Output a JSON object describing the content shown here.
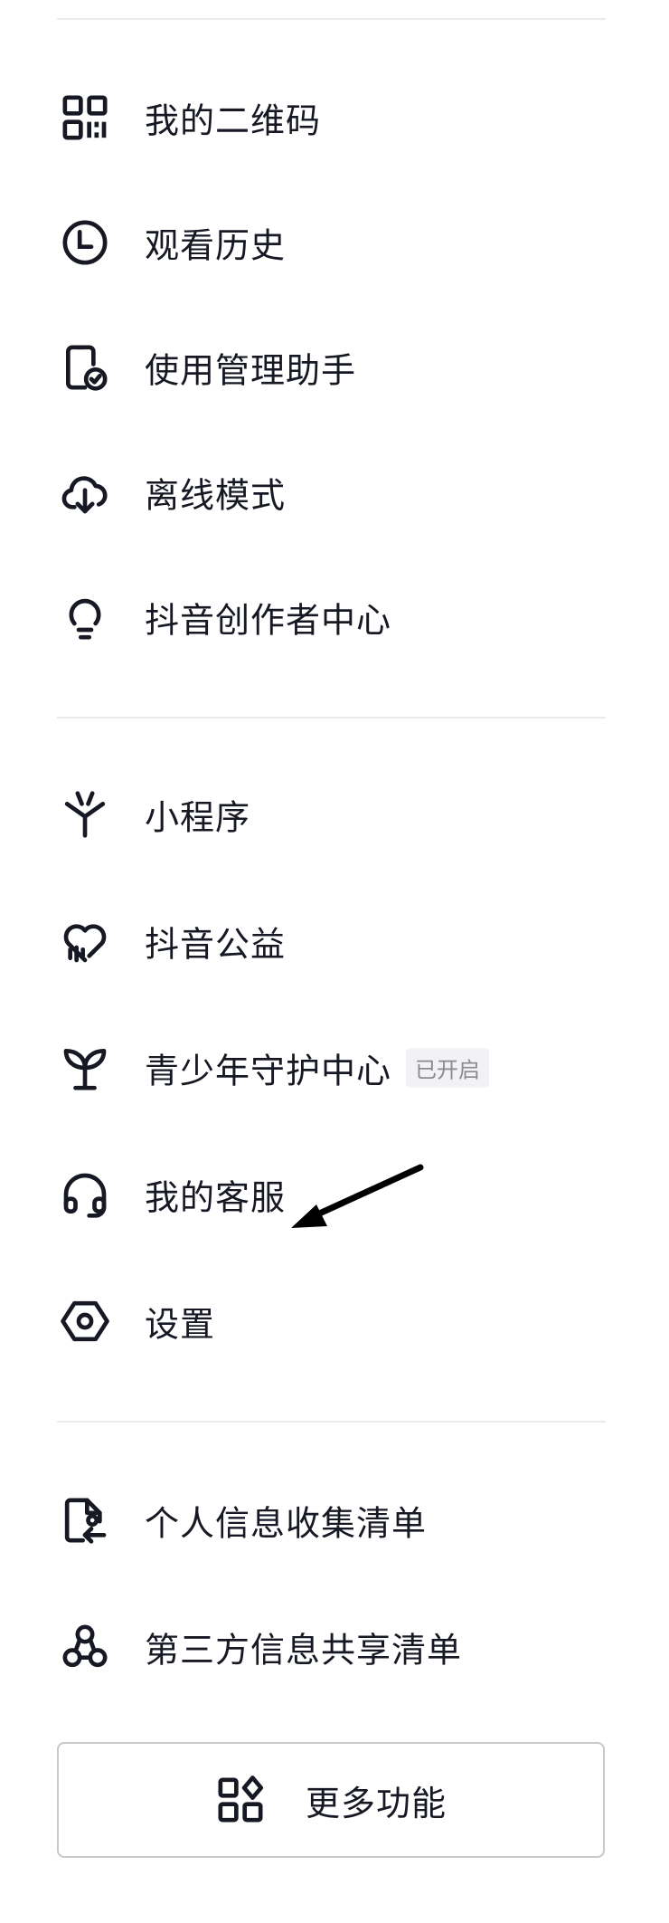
{
  "menu": {
    "section1": [
      {
        "label": "我的二维码",
        "icon": "qr-code-icon"
      },
      {
        "label": "观看历史",
        "icon": "clock-icon"
      },
      {
        "label": "使用管理助手",
        "icon": "phone-check-icon"
      },
      {
        "label": "离线模式",
        "icon": "cloud-download-icon"
      },
      {
        "label": "抖音创作者中心",
        "icon": "lightbulb-icon"
      }
    ],
    "section2": [
      {
        "label": "小程序",
        "icon": "mini-program-icon"
      },
      {
        "label": "抖音公益",
        "icon": "heart-icon"
      },
      {
        "label": "青少年守护中心",
        "icon": "sprout-icon",
        "badge": "已开启"
      },
      {
        "label": "我的客服",
        "icon": "headset-icon"
      },
      {
        "label": "设置",
        "icon": "gear-icon"
      }
    ],
    "section3": [
      {
        "label": "个人信息收集清单",
        "icon": "document-icon"
      },
      {
        "label": "第三方信息共享清单",
        "icon": "share-nodes-icon"
      }
    ]
  },
  "more_button": {
    "label": "更多功能",
    "icon": "grid-plus-icon"
  },
  "colors": {
    "text": "#161823",
    "divider": "#ebebeb",
    "badge_bg": "#f2f2f4",
    "badge_text": "#8a8b91"
  }
}
